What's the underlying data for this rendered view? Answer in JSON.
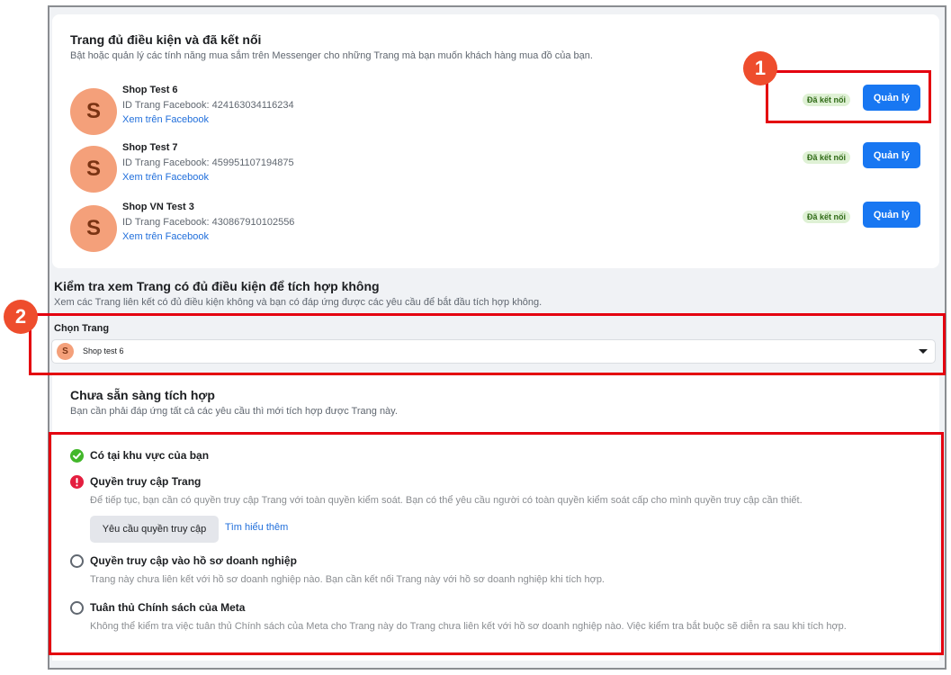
{
  "eligible": {
    "title": "Trang đủ điều kiện và đã kết nối",
    "subtitle": "Bật hoặc quản lý các tính năng mua sắm trên Messenger cho những Trang mà bạn muốn khách hàng mua đồ của bạn.",
    "pages": [
      {
        "initial": "S",
        "name": "Shop Test 6",
        "id_text": "ID Trang Facebook: 424163034116234",
        "link": "Xem trên Facebook",
        "badge": "Đã kết nối",
        "button": "Quản lý"
      },
      {
        "initial": "S",
        "name": "Shop Test 7",
        "id_text": "ID Trang Facebook: 459951107194875",
        "link": "Xem trên Facebook",
        "badge": "Đã kết nối",
        "button": "Quản lý"
      },
      {
        "initial": "S",
        "name": "Shop VN Test 3",
        "id_text": "ID Trang Facebook: 430867910102556",
        "link": "Xem trên Facebook",
        "badge": "Đã kết nối",
        "button": "Quản lý"
      }
    ]
  },
  "check": {
    "title": "Kiểm tra xem Trang có đủ điều kiện để tích hợp không",
    "subtitle": "Xem các Trang liên kết có đủ điều kiện không và bạn có đáp ứng được các yêu cầu để bắt đầu tích hợp không.",
    "select_label": "Chọn Trang",
    "selected_initial": "S",
    "selected_value": "Shop test 6"
  },
  "readiness": {
    "title": "Chưa sẵn sàng tích hợp",
    "subtitle": "Bạn cần phải đáp ứng tất cả các yêu cầu thì mới tích hợp được Trang này.",
    "requirements": [
      {
        "title": "Có tại khu vực của bạn",
        "status": "ok"
      },
      {
        "title": "Quyền truy cập Trang",
        "status": "error",
        "desc": "Để tiếp tục, bạn cần có quyền truy cập Trang với toàn quyền kiểm soát. Bạn có thể yêu cầu người có toàn quyền kiểm soát cấp cho mình quyền truy cập cần thiết."
      },
      {
        "title": "Quyền truy cập vào hồ sơ doanh nghiệp",
        "status": "pending",
        "desc": "Trang này chưa liên kết với hồ sơ doanh nghiệp nào. Bạn cần kết nối Trang này với hồ sơ doanh nghiệp khi tích hợp."
      },
      {
        "title": "Tuân thủ Chính sách của Meta",
        "status": "pending",
        "desc": "Không thể kiểm tra việc tuân thủ Chính sách của Meta cho Trang này do Trang chưa liên kết với hồ sơ doanh nghiệp nào. Việc kiểm tra bắt buộc sẽ diễn ra sau khi tích hợp."
      }
    ],
    "request_button": "Yêu cầu quyền truy cập",
    "learn_more": "Tìm hiểu thêm"
  },
  "annotations": [
    "1",
    "2"
  ],
  "colors": {
    "primary": "#1877f2",
    "annotation": "#e4000f",
    "badge_bg": "#dff1d5",
    "avatar": "#f4a07a"
  }
}
